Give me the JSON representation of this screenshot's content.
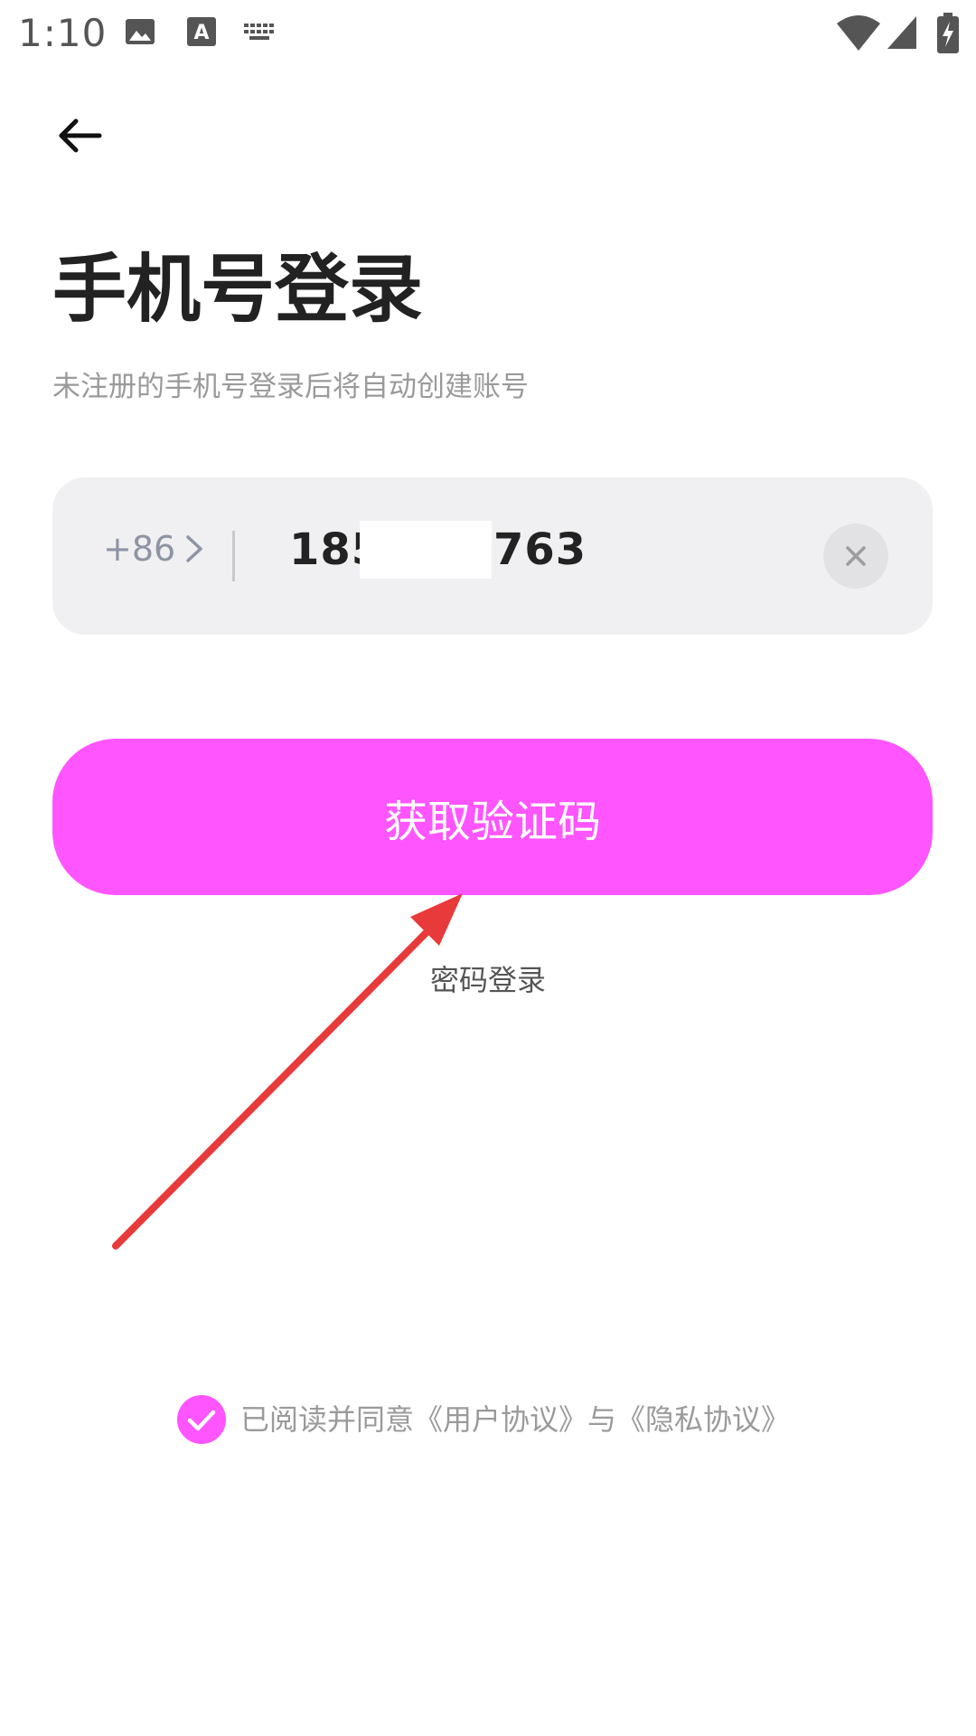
{
  "status_bar": {
    "time": "1:10",
    "icons": [
      "image-icon",
      "text-a-icon",
      "keyboard-icon",
      "wifi-icon",
      "signal-icon",
      "battery-charging-icon"
    ]
  },
  "header": {
    "back_icon": "arrow-left-icon"
  },
  "title": "手机号登录",
  "subtitle": "未注册的手机号登录后将自动创建账号",
  "phone_input": {
    "country_code": "+86",
    "value_start": "185",
    "value_end": "763",
    "clear_icon": "close-icon"
  },
  "get_code_button": {
    "label": "获取验证码",
    "color": "#ff55ff"
  },
  "password_login_link": "密码登录",
  "agreement": {
    "checked": true,
    "text": "已阅读并同意《用户协议》与《隐私协议》"
  },
  "annotation": {
    "color": "#e83a3a"
  }
}
